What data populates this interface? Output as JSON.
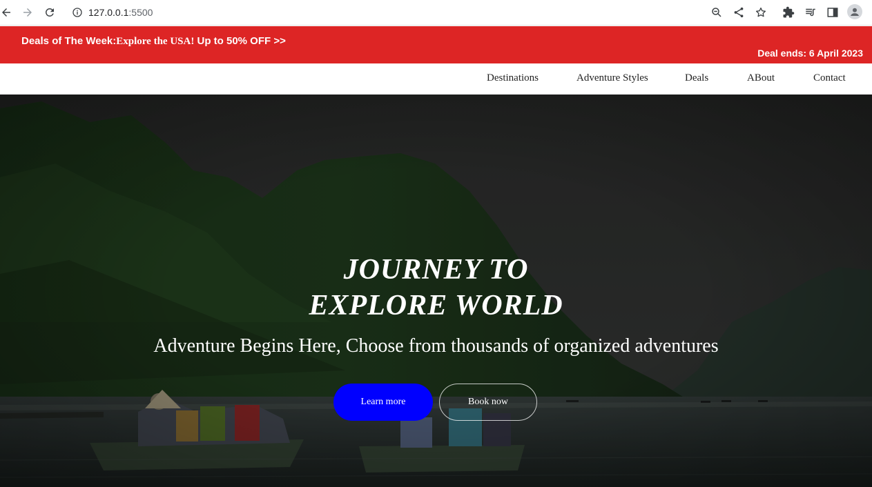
{
  "browser": {
    "url_host": "127.0.0.1",
    "url_port": ":5500"
  },
  "banner": {
    "deal_prefix": "Deals of The Week:",
    "deal_middle": "Explore the USA!",
    "deal_suffix": " Up to 50% OFF >>",
    "deal_ends": "Deal ends: 6 April 2023",
    "color": "#dd2525"
  },
  "nav": {
    "items": [
      {
        "label": "Destinations"
      },
      {
        "label": "Adventure Styles"
      },
      {
        "label": "Deals"
      },
      {
        "label": "ABout"
      },
      {
        "label": "Contact"
      }
    ]
  },
  "hero": {
    "title_line1": "JOURNEY TO",
    "title_line2": "EXPLORE WORLD",
    "subtitle": "Adventure Begins Here, Choose from thousands of organized adventures",
    "learn_more_label": "Learn more",
    "book_now_label": "Book now",
    "learn_more_color": "#0000ff"
  }
}
